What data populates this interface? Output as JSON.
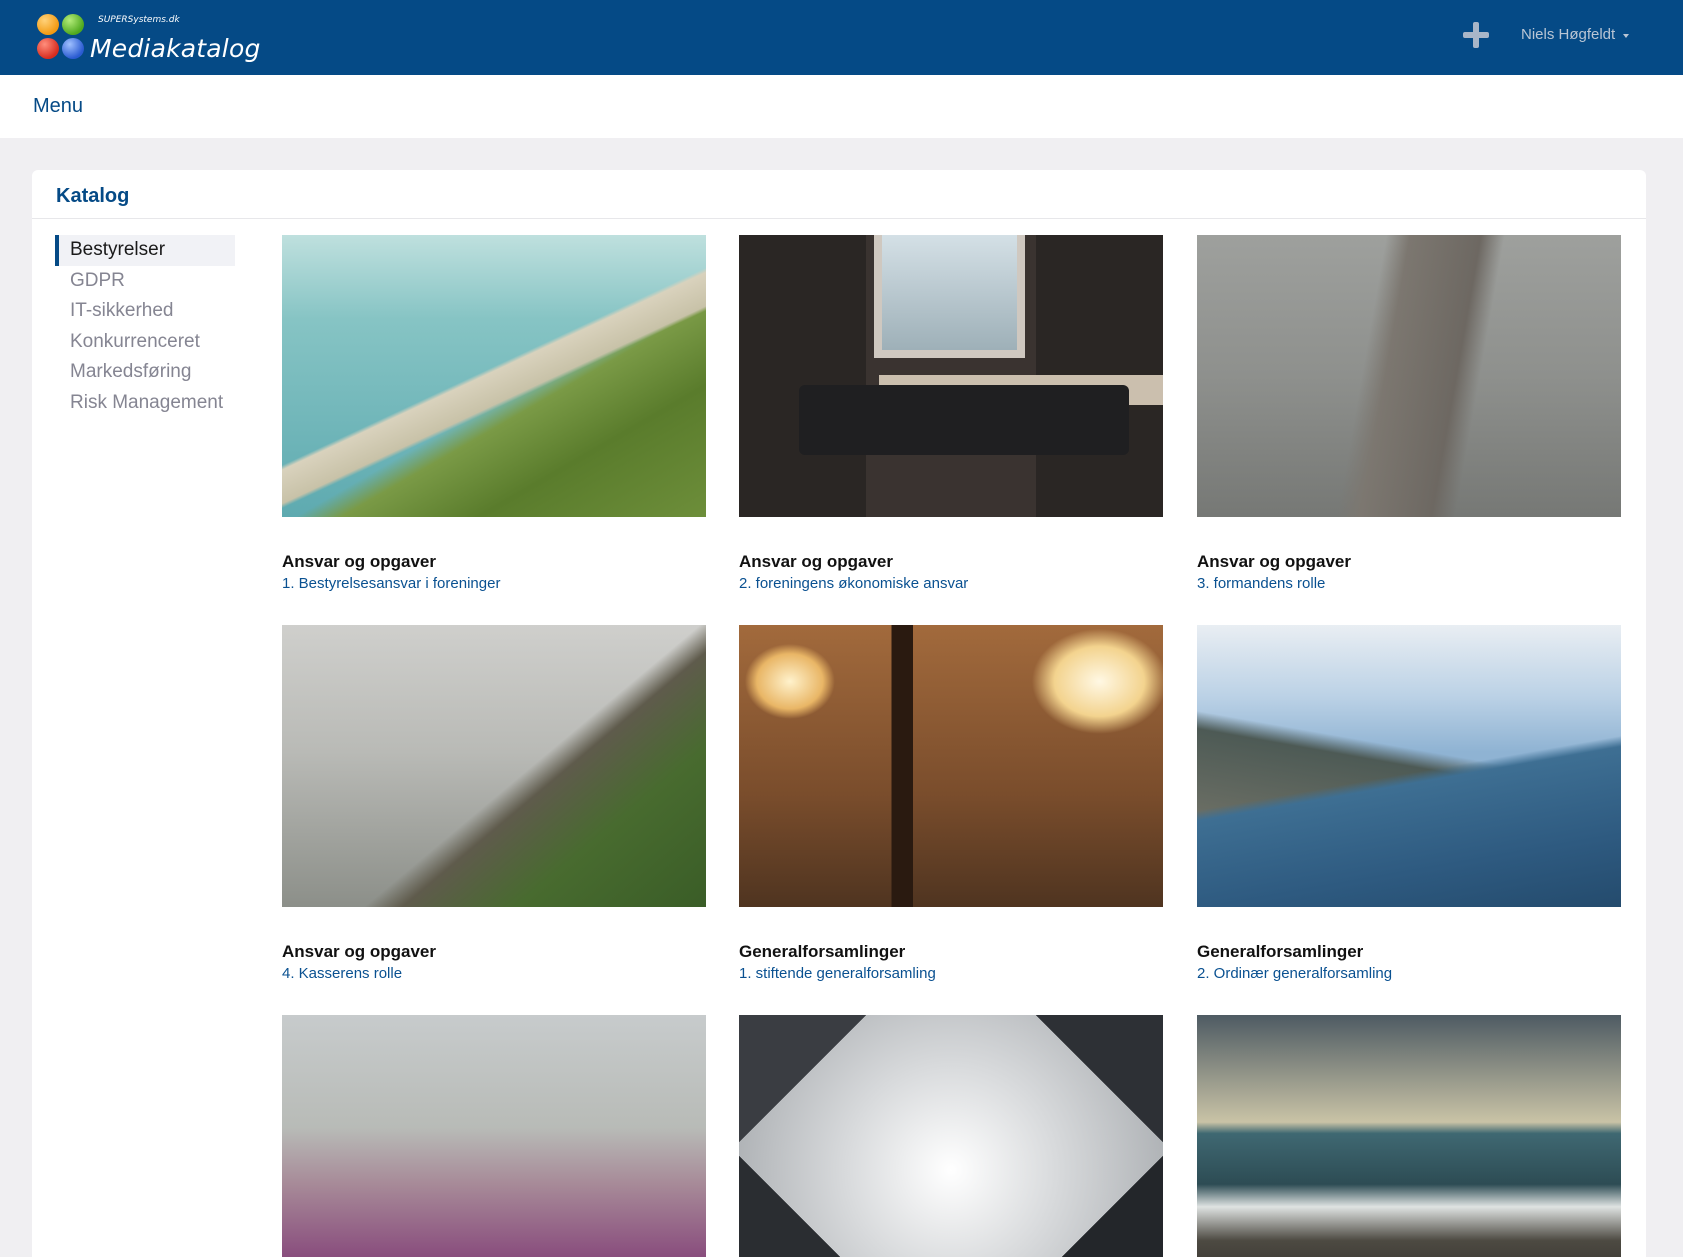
{
  "header": {
    "brand_small": "SUPERSystems.dk",
    "brand_title": "Mediakatalog",
    "user_name": "Niels Høgfeldt",
    "bg_color": "#054a86"
  },
  "menubar": {
    "menu_label": "Menu"
  },
  "catalog": {
    "title": "Katalog",
    "categories": [
      {
        "label": "Bestyrelser",
        "active": true
      },
      {
        "label": "GDPR",
        "active": false
      },
      {
        "label": "IT-sikkerhed",
        "active": false
      },
      {
        "label": "Konkurrenceret",
        "active": false
      },
      {
        "label": "Markedsføring",
        "active": false
      },
      {
        "label": "Risk Management",
        "active": false
      }
    ],
    "items": [
      {
        "title": "Ansvar og opgaver",
        "subtitle": "1. Bestyrelsesansvar i foreninger",
        "image": "cliff-lighthouse"
      },
      {
        "title": "Ansvar og opgaver",
        "subtitle": "2. foreningens økonomiske ansvar",
        "image": "person-on-sofa"
      },
      {
        "title": "Ansvar og opgaver",
        "subtitle": "3. formandens rolle",
        "image": "foggy-pier"
      },
      {
        "title": "Ansvar og opgaver",
        "subtitle": "4. Kasserens rolle",
        "image": "misty-mountain"
      },
      {
        "title": "Generalforsamlinger",
        "subtitle": "1. stiftende generalforsamling",
        "image": "man-in-warehouse"
      },
      {
        "title": "Generalforsamlinger",
        "subtitle": "2. Ordinær generalforsamling",
        "image": "fjord-landscape"
      },
      {
        "title": "",
        "subtitle": "",
        "image": "purple-beach"
      },
      {
        "title": "",
        "subtitle": "",
        "image": "skyscrapers"
      },
      {
        "title": "",
        "subtitle": "",
        "image": "sea-waves"
      }
    ]
  }
}
